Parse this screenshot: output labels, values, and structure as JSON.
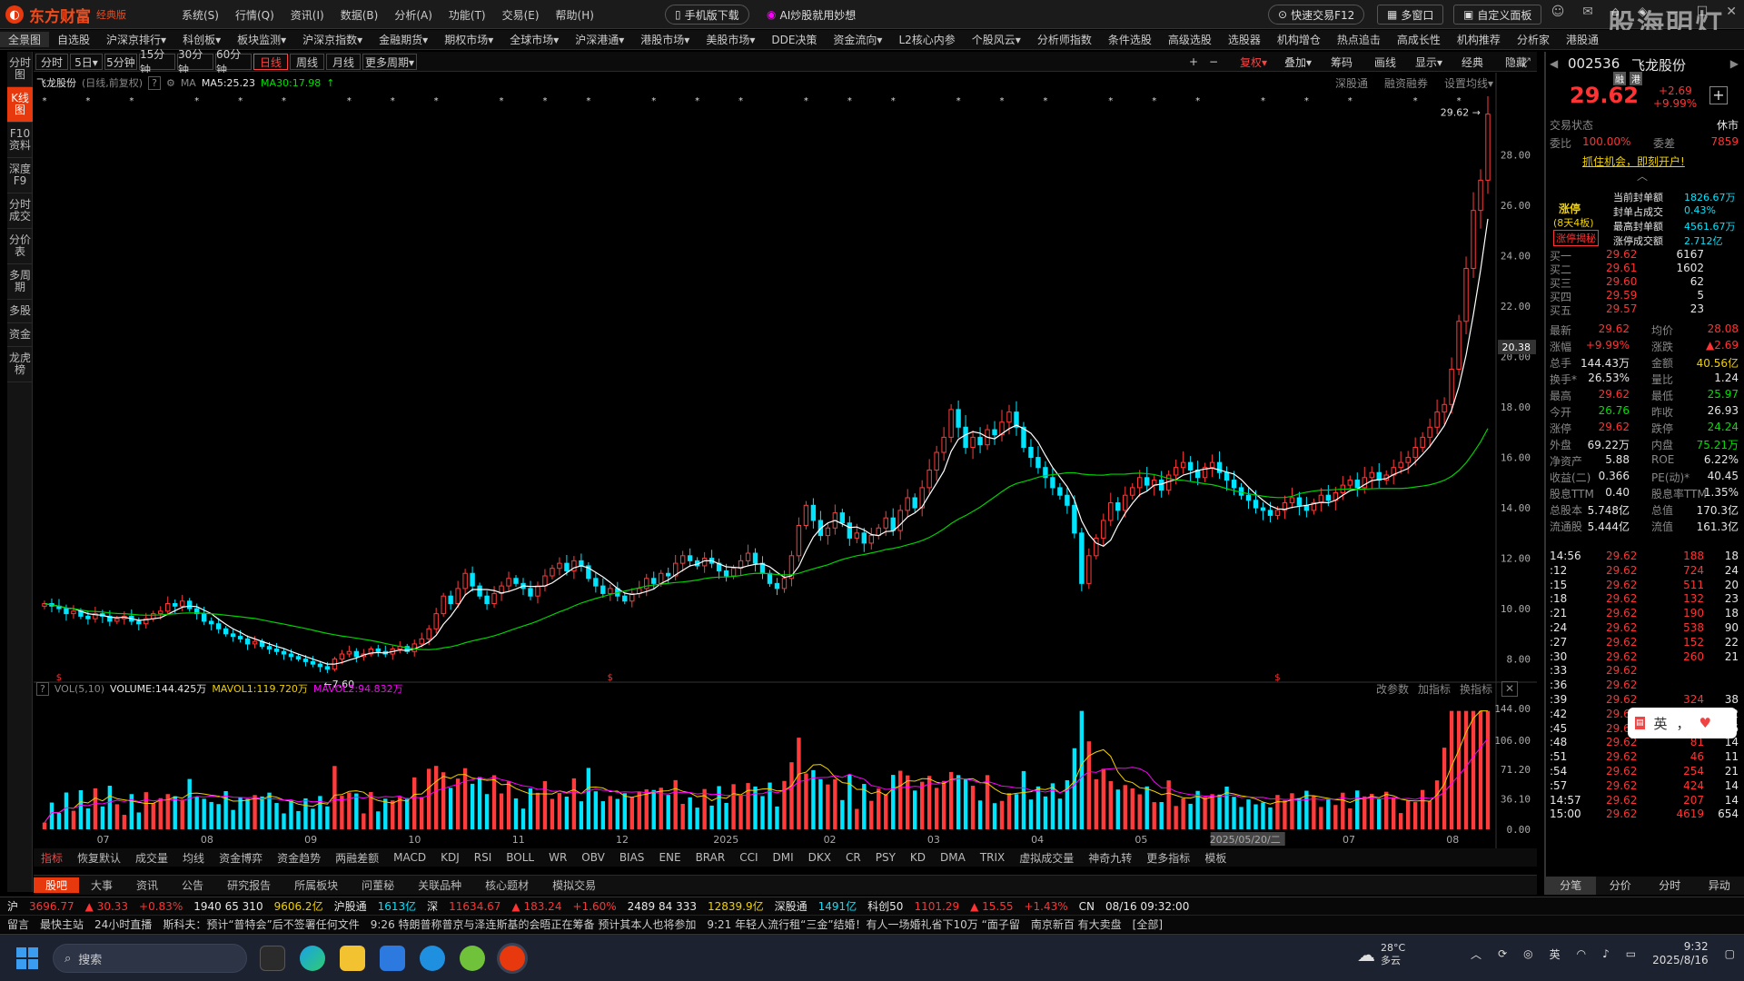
{
  "app": {
    "name": "东方财富",
    "edition": "经典版",
    "watermark": "股海明灯"
  },
  "menu": [
    "系统(S)",
    "行情(Q)",
    "资讯(I)",
    "数据(B)",
    "分析(A)",
    "功能(T)",
    "交易(E)",
    "帮助(H)"
  ],
  "top_buttons": {
    "mobile": "手机版下载",
    "ai": "AI炒股就用妙想",
    "quick_trade": "快速交易F12",
    "multi_window": "多窗口",
    "custom_layout": "自定义面板"
  },
  "navbar": [
    "全景图",
    "自选股",
    "沪深京排行▾",
    "科创板▾",
    "板块监测▾",
    "沪深京指数▾",
    "金融期货▾",
    "期权市场▾",
    "全球市场▾",
    "沪深港通▾",
    "港股市场▾",
    "美股市场▾",
    "DDE决策",
    "资金流向▾",
    "L2核心内参",
    "个股风云▾",
    "分析师指数",
    "条件选股",
    "高级选股",
    "选股器",
    "机构增仓",
    "热点追击",
    "高成长性",
    "机构推荐",
    "分析家",
    "港股通"
  ],
  "left_tabs": [
    "分时图",
    "K线图",
    "F10资料",
    "深度F9",
    "分时成交",
    "分价表",
    "多周期",
    "多股",
    "资金",
    "龙虎榜"
  ],
  "left_tab_active": 1,
  "periods": [
    "分时",
    "5日▾",
    "5分钟",
    "15分钟",
    "30分钟",
    "60分钟",
    "日线",
    "周线",
    "月线",
    "更多周期▾"
  ],
  "period_active": 6,
  "chart_tools": [
    "复权▾",
    "叠加▾",
    "筹码",
    "画线",
    "显示▾",
    "经典",
    "隐藏"
  ],
  "chart_header": {
    "stock": "飞龙股份",
    "mode": "(日线,前复权)",
    "ma_label": "MA",
    "ma5": "MA5:25.23",
    "ma30": "MA30:17.98",
    "links": [
      "深股通",
      "融资融券",
      "设置均线▾"
    ]
  },
  "vol_header": {
    "label": "VOL(5,10)",
    "volume": "VOLUME:144.425万",
    "mavol1": "MAVOL1:119.720万",
    "mavol2": "MAVOL2:94.832万",
    "links": [
      "改参数",
      "加指标",
      "换指标"
    ]
  },
  "indicators": [
    "指标",
    "恢复默认",
    "成交量",
    "均线",
    "资金博弈",
    "资金趋势",
    "两融差额",
    "MACD",
    "KDJ",
    "RSI",
    "BOLL",
    "WR",
    "OBV",
    "BIAS",
    "ENE",
    "BRAR",
    "CCI",
    "DMI",
    "DKX",
    "CR",
    "PSY",
    "KD",
    "DMA",
    "TRIX",
    "虚拟成交量",
    "神奇九转",
    "更多指标",
    "模板"
  ],
  "bottom_tabs": [
    "股吧",
    "大事",
    "资讯",
    "公告",
    "研究报告",
    "所属板块",
    "问董秘",
    "关联品种",
    "核心题材",
    "模拟交易"
  ],
  "chart_data": {
    "type": "candlestick",
    "x_labels": [
      "07",
      "08",
      "09",
      "10",
      "11",
      "12",
      "2025",
      "02",
      "03",
      "04",
      "05",
      "2025/05/20/二",
      "07",
      "08"
    ],
    "y_ticks": [
      8.0,
      10.0,
      12.0,
      14.0,
      16.0,
      18.0,
      20.0,
      22.0,
      24.0,
      26.0,
      28.0
    ],
    "ylim": [
      7.3,
      30.4
    ],
    "cursor_price": "20.38",
    "high_label": "29.62",
    "low_label": "7.60",
    "closes": [
      10.2,
      10.1,
      10.0,
      9.8,
      9.9,
      9.7,
      9.6,
      9.8,
      9.7,
      9.5,
      9.6,
      9.7,
      9.5,
      9.4,
      9.6,
      9.8,
      9.9,
      10.2,
      10.1,
      10.3,
      10.0,
      9.8,
      9.5,
      9.4,
      9.2,
      9.0,
      8.9,
      8.8,
      8.6,
      8.7,
      8.5,
      8.4,
      8.3,
      8.2,
      8.1,
      8.0,
      7.9,
      7.8,
      7.7,
      7.6,
      8.0,
      8.2,
      8.3,
      8.1,
      8.2,
      8.4,
      8.3,
      8.2,
      8.4,
      8.5,
      8.3,
      8.6,
      8.8,
      9.2,
      9.8,
      10.5,
      10.2,
      10.8,
      11.4,
      10.9,
      10.5,
      10.2,
      10.6,
      10.9,
      11.2,
      11.0,
      10.8,
      10.5,
      10.9,
      11.3,
      11.6,
      11.8,
      11.5,
      11.9,
      11.7,
      11.2,
      10.9,
      10.6,
      10.8,
      10.5,
      10.3,
      10.6,
      10.8,
      11.2,
      11.0,
      11.4,
      11.3,
      11.8,
      12.1,
      11.9,
      11.7,
      12.0,
      11.8,
      11.5,
      11.3,
      11.6,
      11.9,
      12.2,
      11.8,
      11.4,
      11.0,
      10.8,
      11.2,
      12.1,
      13.3,
      14.1,
      13.5,
      12.9,
      13.2,
      13.8,
      13.4,
      12.8,
      13.0,
      12.6,
      12.9,
      13.2,
      13.6,
      13.1,
      13.9,
      14.4,
      14.0,
      14.8,
      15.5,
      16.2,
      16.8,
      17.9,
      17.2,
      16.4,
      16.8,
      16.5,
      17.1,
      16.9,
      17.4,
      17.8,
      17.2,
      16.4,
      16.0,
      15.6,
      15.2,
      14.8,
      14.5,
      14.1,
      13.0,
      11.0,
      12.1,
      12.8,
      13.5,
      14.2,
      13.9,
      14.5,
      14.8,
      15.2,
      14.9,
      15.1,
      14.7,
      15.3,
      15.6,
      15.8,
      15.5,
      15.2,
      15.6,
      15.8,
      15.4,
      15.1,
      14.8,
      14.5,
      14.3,
      14.0,
      13.9,
      13.7,
      13.9,
      14.2,
      14.4,
      14.1,
      13.9,
      14.2,
      14.5,
      14.3,
      14.6,
      14.9,
      15.1,
      14.8,
      15.2,
      15.4,
      15.1,
      15.3,
      15.6,
      15.8,
      16.0,
      16.4,
      16.8,
      17.2,
      17.8,
      18.1,
      19.5,
      21.4,
      23.5,
      25.8,
      27.0,
      29.62
    ],
    "ma5_last": 25.23,
    "ma30_last": 17.98,
    "volume": {
      "series": [
        "VOLUME",
        "MAVOL1",
        "MAVOL2"
      ],
      "last": [
        144.425,
        119.72,
        94.832
      ],
      "unit": "万",
      "y_ticks": [
        0.0,
        36.1,
        71.2,
        106.0,
        144.0
      ]
    }
  },
  "quote": {
    "code": "002536",
    "name": "飞龙股份",
    "tags": [
      "融",
      "港"
    ],
    "price": "29.62",
    "change": "+2.69",
    "pct": "+9.99%",
    "status_label": "交易状态",
    "status": "休市",
    "weibi_label": "委比",
    "weibi": "100.00%",
    "weicha_label": "委差",
    "weicha": "7859",
    "promo": "抓住机会，即刻开户!",
    "limit_up": {
      "title": "涨停",
      "days": "(8天4板)",
      "reveal": "涨停揭秘",
      "rows": [
        [
          "当前封单额",
          "1826.67万"
        ],
        [
          "封单占成交",
          "0.43%"
        ],
        [
          "最高封单额",
          "4561.67万"
        ],
        [
          "涨停成交额",
          "2.712亿"
        ]
      ]
    },
    "asks": [
      [
        "买一",
        "29.62",
        "6167"
      ],
      [
        "买二",
        "29.61",
        "1602"
      ],
      [
        "买三",
        "29.60",
        "62"
      ],
      [
        "买四",
        "29.59",
        "5"
      ],
      [
        "买五",
        "29.57",
        "23"
      ]
    ],
    "stats": [
      [
        "最新",
        "29.62",
        "均价",
        "28.08"
      ],
      [
        "涨幅",
        "+9.99%",
        "涨跌",
        "▲2.69"
      ],
      [
        "总手",
        "144.43万",
        "金额",
        "40.56亿"
      ],
      [
        "换手*",
        "26.53%",
        "量比",
        "1.24"
      ],
      [
        "最高",
        "29.62",
        "最低",
        "25.97"
      ],
      [
        "今开",
        "26.76",
        "昨收",
        "26.93"
      ],
      [
        "涨停",
        "29.62",
        "跌停",
        "24.24"
      ],
      [
        "外盘",
        "69.22万",
        "内盘",
        "75.21万"
      ],
      [
        "净资产",
        "5.88",
        "ROE",
        "6.22%"
      ],
      [
        "收益(二)",
        "0.366",
        "PE(动)*",
        "40.45"
      ],
      [
        "股息TTM",
        "0.40",
        "股息率TTM",
        "1.35%"
      ],
      [
        "总股本",
        "5.748亿",
        "总值",
        "170.3亿"
      ],
      [
        "流通股",
        "5.444亿",
        "流值",
        "161.3亿"
      ]
    ],
    "trades": [
      [
        "14:56",
        "29.62",
        "188",
        "18"
      ],
      [
        ":12",
        "29.62",
        "724",
        "24"
      ],
      [
        ":15",
        "29.62",
        "511",
        "20"
      ],
      [
        ":18",
        "29.62",
        "132",
        "23"
      ],
      [
        ":21",
        "29.62",
        "190",
        "18"
      ],
      [
        ":24",
        "29.62",
        "538",
        "90"
      ],
      [
        ":27",
        "29.62",
        "152",
        "22"
      ],
      [
        ":30",
        "29.62",
        "260",
        "21"
      ],
      [
        ":33",
        "29.62",
        "",
        ""
      ],
      [
        ":36",
        "29.62",
        "",
        ""
      ],
      [
        ":39",
        "29.62",
        "324",
        "38"
      ],
      [
        ":42",
        "29.62",
        "58",
        "12"
      ],
      [
        ":45",
        "29.62",
        "193",
        "16"
      ],
      [
        ":48",
        "29.62",
        "81",
        "14"
      ],
      [
        ":51",
        "29.62",
        "46",
        "11"
      ],
      [
        ":54",
        "29.62",
        "254",
        "21"
      ],
      [
        ":57",
        "29.62",
        "424",
        "14"
      ],
      [
        "14:57",
        "29.62",
        "207",
        "14"
      ],
      [
        "15:00",
        "29.62",
        "4619",
        "654"
      ]
    ],
    "bottom_tabs": [
      "分笔",
      "分价",
      "分时",
      "异动"
    ],
    "ime": "英"
  },
  "ticker": {
    "sh": "沪",
    "sh_val": "3696.77",
    "sh_chg": "▲ 30.33",
    "sh_pct": "+0.83%",
    "sh_counts": "1940 65 310",
    "sh_amt": "9606.2亿",
    "hgt": "沪股通",
    "hgt_val": "1613亿",
    "sz": "深",
    "sz_val": "11634.67",
    "sz_chg": "▲ 183.24",
    "sz_pct": "+1.60%",
    "sz_counts": "2489 84 333",
    "sz_amt": "12839.9亿",
    "sgt": "深股通",
    "sgt_val": "1491亿",
    "kc": "科创50",
    "kc_val": "1101.29",
    "kc_chg": "▲ 15.55",
    "kc_pct": "+1.43%",
    "region": "CN",
    "datetime": "08/16 09:32:00"
  },
  "newsline": {
    "items": [
      "留言",
      "最快主站",
      "24小时直播",
      "斯科夫：预计“普特会”后不签署任何文件",
      "9:26 特朗普称普京与泽连斯基的会晤正在筹备 预计其本人也将参加",
      "9:21 年轻人流行租“三金”结婚！有人一场婚礼省下10万 “面子留",
      "南京新百 有大卖盘",
      "[全部]"
    ]
  },
  "taskbar": {
    "search": "搜索",
    "weather_temp": "28°C",
    "weather_desc": "多云",
    "time": "9:32",
    "date": "2025/8/16",
    "lang": "英"
  }
}
